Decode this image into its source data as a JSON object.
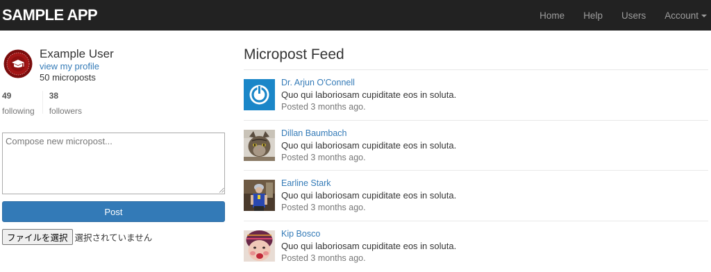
{
  "navbar": {
    "brand": "SAMPLE APP",
    "links": {
      "home": "Home",
      "help": "Help",
      "users": "Users",
      "account": "Account"
    },
    "background": "#222222"
  },
  "sidebar": {
    "user_name": "Example User",
    "profile_link": "view my profile",
    "micropost_count": "50 microposts",
    "stats": {
      "following_count": "49",
      "following_label": "following",
      "followers_count": "38",
      "followers_label": "followers"
    },
    "compose_placeholder": "Compose new micropost...",
    "post_button": "Post",
    "file_button": "ファイルを選択",
    "file_status": "選択されていません"
  },
  "feed": {
    "title": "Micropost Feed",
    "items": [
      {
        "user": "Dr. Arjun O'Connell",
        "content": "Quo qui laboriosam cupiditate eos in soluta.",
        "timestamp": "Posted 3 months ago.",
        "avatar": "power-logo-avatar"
      },
      {
        "user": "Dillan Baumbach",
        "content": "Quo qui laboriosam cupiditate eos in soluta.",
        "timestamp": "Posted 3 months ago.",
        "avatar": "cat-photo-avatar"
      },
      {
        "user": "Earline Stark",
        "content": "Quo qui laboriosam cupiditate eos in soluta.",
        "timestamp": "Posted 3 months ago.",
        "avatar": "person-photo-avatar"
      },
      {
        "user": "Kip Bosco",
        "content": "Quo qui laboriosam cupiditate eos in soluta.",
        "timestamp": "Posted 3 months ago.",
        "avatar": "child-photo-avatar"
      }
    ]
  },
  "colors": {
    "link": "#337ab7",
    "primary_button": "#337ab7",
    "muted_text": "#777777"
  }
}
